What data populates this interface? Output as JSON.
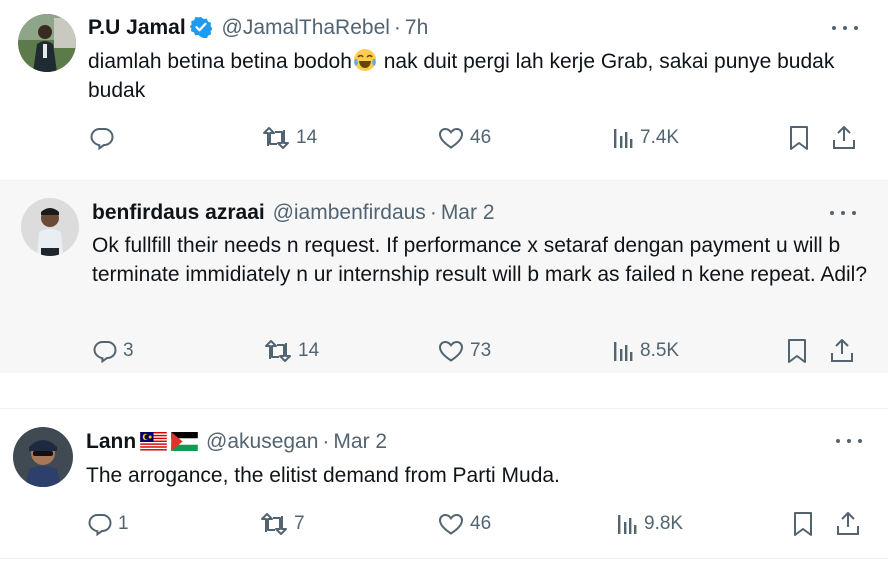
{
  "tweets": [
    {
      "name": "P.U Jamal",
      "handle": "@JamalThaRebel",
      "separator": "·",
      "time": "7h",
      "text_before": "diamlah betina betina bodoh",
      "text_after": " nak duit pergi lah kerje Grab, sakai punye budak budak",
      "replies": "",
      "reposts": "14",
      "likes": "46",
      "views": "7.4K"
    },
    {
      "name": "benfirdaus azraai",
      "handle": "@iambenfirdaus",
      "separator": "·",
      "time": "Mar 2",
      "text": "Ok fullfill their needs n request. If performance x setaraf dengan payment u will b terminate immidiately n ur internship result will b mark as failed n kene repeat. Adil?",
      "replies": "3",
      "reposts": "14",
      "likes": "73",
      "views": "8.5K"
    },
    {
      "name": "Lann",
      "handle": "@akusegan",
      "separator": "·",
      "time": "Mar 2",
      "text": "The arrogance, the elitist demand from Parti Muda.",
      "replies": "1",
      "reposts": "7",
      "likes": "46",
      "views": "9.8K"
    }
  ],
  "colors": {
    "text": "#0f1419",
    "muted": "#536471",
    "verified": "#1d9bf0",
    "highlight_bg": "#f7f7f7",
    "divider": "#eff3f4"
  },
  "icons": [
    "verified-badge-icon",
    "more-icon",
    "reply-icon",
    "repost-icon",
    "like-icon",
    "views-icon",
    "bookmark-icon",
    "share-icon",
    "tears-of-joy-emoji",
    "malaysia-flag",
    "palestine-flag"
  ]
}
